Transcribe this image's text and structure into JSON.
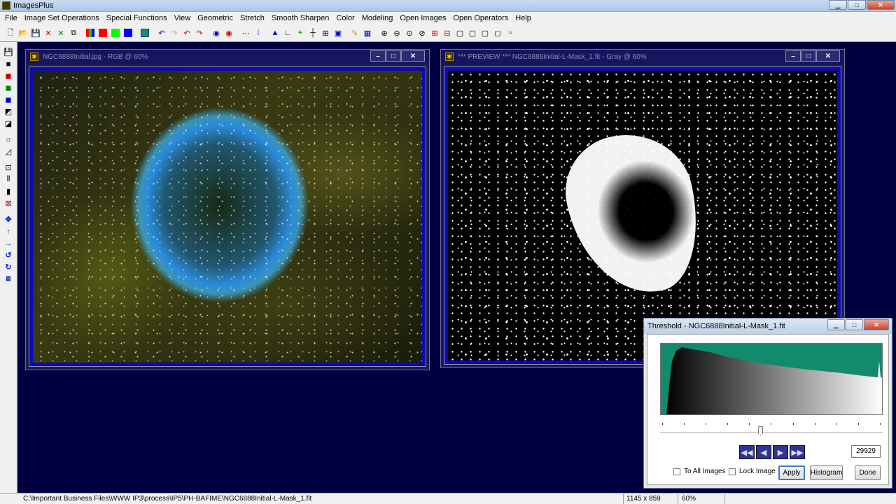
{
  "app": {
    "title": "ImagesPlus"
  },
  "menu": [
    "File",
    "Image Set Operations",
    "Special Functions",
    "View",
    "Geometric",
    "Stretch",
    "Smooth Sharpen",
    "Color",
    "Modeling",
    "Open Images",
    "Open Operators",
    "Help"
  ],
  "window1": {
    "title": "NGC6888Initial.jpg - RGB @ 60%"
  },
  "window2": {
    "title": "*** PREVIEW *** NGC6888Initial-L-Mask_1.fit - Gray @ 60%"
  },
  "threshold": {
    "title": "Threshold - NGC6888Initial-L-Mask_1.fit",
    "value": "29929",
    "slider_fraction": 0.45,
    "to_all_images": "To All Images",
    "lock_image": "Lock Image",
    "apply": "Apply",
    "histogram": "Histogram",
    "done": "Done",
    "histo_color": "#128a6e"
  },
  "status": {
    "path": "C:\\Important Business Files\\WWW IP3\\process\\IP5\\PH-BAFIME\\NGC6888Initial-L-Mask_1.fit",
    "dims": "1145 x 859",
    "zoom": "60%"
  }
}
